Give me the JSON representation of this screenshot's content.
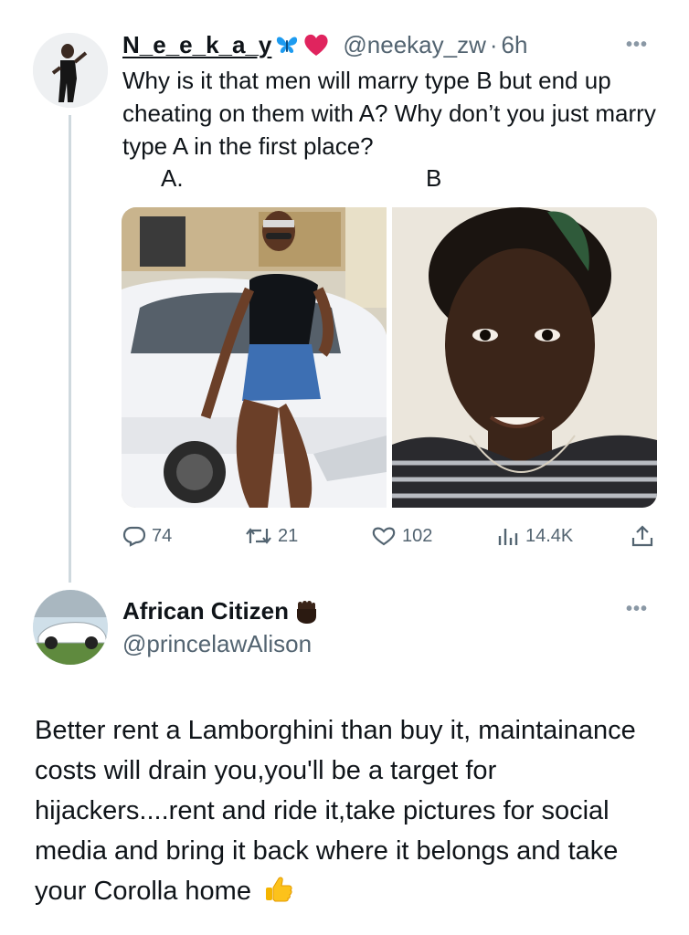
{
  "tweet1": {
    "name": "N_e_e_k_a_y",
    "name_emojis": [
      "butterfly-emoji",
      "red-heart-emoji"
    ],
    "handle": "@neekay_zw",
    "separator": "·",
    "time": "6h",
    "more_label": "•••",
    "text": "Why is it that men will marry type B but end up cheating on them with A? Why don’t you just marry type A in the first place?",
    "label_a": "A.",
    "label_b": "B",
    "actions": {
      "replies": "74",
      "retweets": "21",
      "likes": "102",
      "views": "14.4K"
    }
  },
  "tweet2": {
    "name": "African Citizen",
    "name_emoji": "raised-fist-emoji",
    "handle": "@princelawAlison",
    "more_label": "•••",
    "text": "Better rent a Lamborghini than buy it, maintainance costs will drain you,you'll be a target for hijackers....rent and ride it,take pictures for social media and bring it back where it belongs and take your Corolla home",
    "trailing_emoji": "thumbs-up-emoji"
  },
  "colors": {
    "text": "#0f1419",
    "secondary": "#536471",
    "thread_line": "#cfd9de",
    "butterfly": "#1d9bf0",
    "heart": "#e0245e",
    "thumbs": "#f4b400"
  }
}
